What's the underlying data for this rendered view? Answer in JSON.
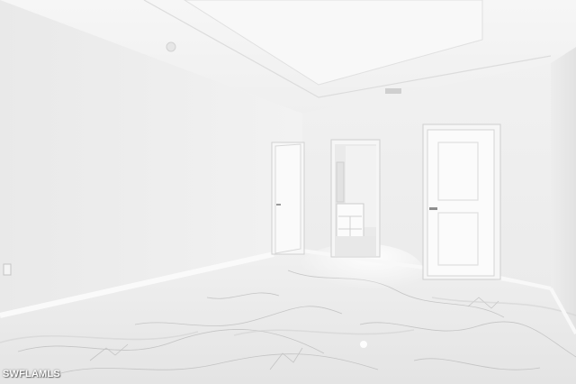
{
  "photo": {
    "watermark": "SWFLAMLS",
    "colors": {
      "ceiling": "#f3f3f3",
      "wall_left": "#ececec",
      "wall_back": "#efefef",
      "wall_right": "#e6e6e6",
      "floor": "#ececec",
      "marble_vein": "#b9b9b9",
      "door": "#fafafa",
      "trim": "#f6f6f6"
    }
  }
}
